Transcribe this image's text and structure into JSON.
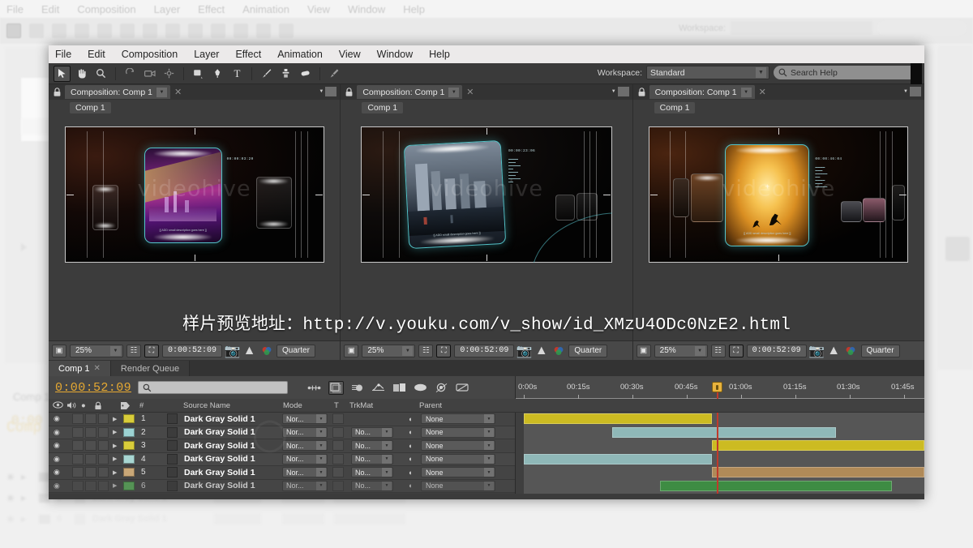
{
  "app": {
    "menu": [
      "File",
      "Edit",
      "Composition",
      "Layer",
      "Effect",
      "Animation",
      "View",
      "Window",
      "Help"
    ]
  },
  "toolbar": {
    "workspace_label": "Workspace:",
    "workspace_value": "Standard",
    "search_placeholder": "Search Help",
    "tools": [
      {
        "name": "selection-tool",
        "glyph": "arrow",
        "selected": true
      },
      {
        "name": "hand-tool",
        "glyph": "hand",
        "selected": false
      },
      {
        "name": "zoom-tool",
        "glyph": "magnifier",
        "selected": false
      },
      {
        "name": "rotation-tool",
        "glyph": "rotate",
        "selected": false
      },
      {
        "name": "camera-tool",
        "glyph": "camera",
        "selected": false
      },
      {
        "name": "pan-behind-tool",
        "glyph": "anchor",
        "selected": false
      },
      {
        "name": "shape-tool",
        "glyph": "square",
        "selected": false
      },
      {
        "name": "pen-tool",
        "glyph": "pen",
        "selected": false
      },
      {
        "name": "type-tool",
        "glyph": "T",
        "selected": false
      },
      {
        "name": "brush-tool",
        "glyph": "brush",
        "selected": false
      },
      {
        "name": "clone-stamp-tool",
        "glyph": "stamp",
        "selected": false
      },
      {
        "name": "eraser-tool",
        "glyph": "eraser",
        "selected": false
      },
      {
        "name": "roto-brush-tool",
        "glyph": "roto",
        "selected": false
      }
    ]
  },
  "composition_panels": [
    {
      "tab_title": "Composition: Comp 1",
      "breadcrumb": "Comp 1",
      "watermark": "videohive",
      "preview_timecode": "00:00:03:20",
      "caption": "[[ ADD small description goes here ]]",
      "zoom": "25%",
      "timecode": "0:00:52:09",
      "resolution": "Quarter",
      "scene": "bridge-night-purple"
    },
    {
      "tab_title": "Composition: Comp 1",
      "breadcrumb": "Comp 1",
      "watermark": "videohive",
      "preview_timecode": "00:00:23:06",
      "caption": "[[ ADD small description goes here ]]",
      "zoom": "25%",
      "timecode": "0:00:52:09",
      "resolution": "Quarter",
      "scene": "city-skyline-gray"
    },
    {
      "tab_title": "Composition: Comp 1",
      "breadcrumb": "Comp 1",
      "watermark": "videohive",
      "preview_timecode": "00:00:46:04",
      "caption": "[[ ADD small description goes here ]]",
      "zoom": "25%",
      "timecode": "0:00:52:09",
      "resolution": "Quarter",
      "scene": "sunset-kangaroo-gold"
    }
  ],
  "overlay": {
    "url_text": "样片预览地址：http://v.youku.com/v_show/id_XMzU4ODc0NzE2.html"
  },
  "timeline": {
    "tabs": [
      {
        "label": "Comp 1",
        "active": true,
        "closeable": true
      },
      {
        "label": "Render Queue",
        "active": false,
        "closeable": false
      }
    ],
    "current_time": "0:00:52:09",
    "search_value": "",
    "columns": [
      "Source Name",
      "Mode",
      "T",
      "TrkMat",
      "Parent"
    ],
    "ruler_labels": [
      "0:00s",
      "00:15s",
      "00:30s",
      "00:45s",
      "01:00s",
      "01:15s",
      "01:30s",
      "01:45s"
    ],
    "playhead_time": "0:00:52:09",
    "layers": [
      {
        "index": "1",
        "name": "Dark Gray Solid 1",
        "mode": "Nor...",
        "trkmat": "",
        "parent": "None",
        "label_color": "#d8cc3a",
        "bar_color": "#ccbb22",
        "bar_start": 0,
        "bar_end": 47
      },
      {
        "index": "2",
        "name": "Dark Gray Solid 1",
        "mode": "Nor...",
        "trkmat": "No...",
        "parent": "None",
        "label_color": "#9cd2d2",
        "bar_color": "#8fb8b8",
        "bar_start": 22,
        "bar_end": 78
      },
      {
        "index": "3",
        "name": "Dark Gray Solid 1",
        "mode": "Nor...",
        "trkmat": "No...",
        "parent": "None",
        "label_color": "#d8cc3a",
        "bar_color": "#ccbb22",
        "bar_start": 47,
        "bar_end": 100
      },
      {
        "index": "4",
        "name": "Dark Gray Solid 1",
        "mode": "Nor...",
        "trkmat": "No...",
        "parent": "None",
        "label_color": "#a8d6d2",
        "bar_color": "#8fb8b8",
        "bar_start": 0,
        "bar_end": 47
      },
      {
        "index": "5",
        "name": "Dark Gray Solid 1",
        "mode": "Nor...",
        "trkmat": "No...",
        "parent": "None",
        "label_color": "#c9a777",
        "bar_color": "#b08a58",
        "bar_start": 47,
        "bar_end": 100
      },
      {
        "index": "6",
        "name": "Dark Gray Solid 1",
        "mode": "Nor...",
        "trkmat": "No...",
        "parent": "None",
        "label_color": "#5fb55f",
        "bar_color": "#3e8c43",
        "bar_start": 34,
        "bar_end": 92
      }
    ]
  },
  "background_ghost": {
    "timeline_tab": "Comp 1",
    "timecode": "0:00",
    "rows": [
      {
        "index": "4",
        "name": "Dark Gray Solid 1",
        "mode": "Nor...",
        "trkmat": "No...",
        "parent": "None"
      },
      {
        "index": "5",
        "name": "Dark Gray Solid 1",
        "mode": "Nor...",
        "trkmat": "No...",
        "parent": "None"
      },
      {
        "index": "6",
        "name": "Dark Gray Solid 1",
        "mode": "Nor...",
        "trkmat": "No...",
        "parent": "None"
      }
    ],
    "project_label": "Na",
    "comp_label": "Comp"
  },
  "colors": {
    "menu_bg": "#eceaea",
    "panel_bg": "#3c3c3c",
    "timeline_bg": "#3e3e3e",
    "accent_orange": "#e6a932",
    "playhead_red": "#c0392b",
    "card_teal": "#54c3c9"
  }
}
